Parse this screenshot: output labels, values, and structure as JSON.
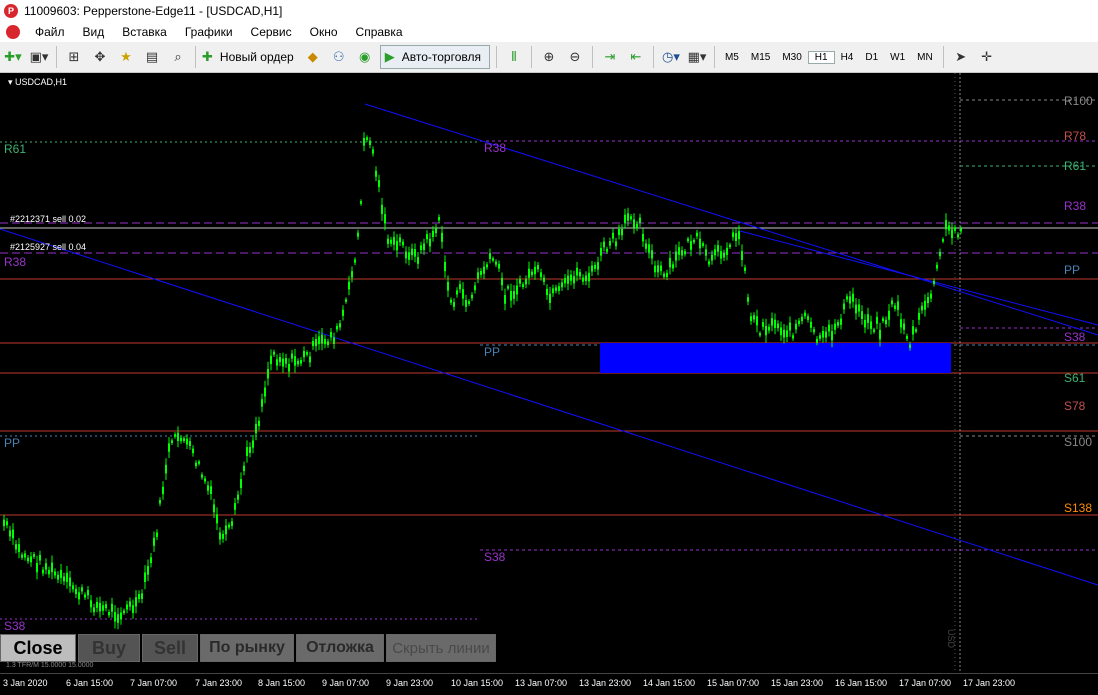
{
  "window": {
    "title": "11009603: Pepperstone-Edge11 - [USDCAD,H1]"
  },
  "menu": [
    "Файл",
    "Вид",
    "Вставка",
    "Графики",
    "Сервис",
    "Окно",
    "Справка"
  ],
  "toolbar": {
    "new_order": "Новый ордер",
    "autotrading": "Авто-торговля",
    "timeframes": [
      "M5",
      "M15",
      "M30",
      "H1",
      "H4",
      "D1",
      "W1",
      "MN"
    ],
    "active_timeframe": "H1"
  },
  "chart": {
    "symbol_label": "USDCAD,H1",
    "orders": [
      "#2212371 sell 0.02",
      "#2125927 sell 0.04"
    ],
    "levels_right": [
      "R100",
      "R78",
      "R61",
      "R38",
      "PP",
      "S38",
      "S61",
      "S78",
      "S100",
      "S138"
    ],
    "levels_left": [
      "R61",
      "R38",
      "PP",
      "S38"
    ],
    "levels_mid": [
      "R38",
      "PP",
      "S38"
    ],
    "level_colors": {
      "R100": "#888888",
      "R78": "#c0504d",
      "R61": "#3cb371",
      "R38": "#9932cc",
      "PP": "#4682b4",
      "S38": "#9932cc",
      "S61": "#3cb371",
      "S78": "#c0504d",
      "S100": "#888888",
      "S138": "#ff8c00"
    },
    "candle_color": "#00ff00",
    "trendline_color": "#0000ff",
    "zone_color": "#0000ff",
    "watermark": "USD"
  },
  "buttons": {
    "close": "Close",
    "buy": "Buy",
    "sell": "Sell",
    "market": "По рынку",
    "pending": "Отложка",
    "hide_lines": "Скрыть линии"
  },
  "bottom_strip": "1.3 TFR/M 15.0000 15.0000",
  "time_axis": [
    "3 Jan 2020",
    "6 Jan 15:00",
    "7 Jan 07:00",
    "7 Jan 23:00",
    "8 Jan 15:00",
    "9 Jan 07:00",
    "9 Jan 23:00",
    "10 Jan 15:00",
    "13 Jan 07:00",
    "13 Jan 23:00",
    "14 Jan 15:00",
    "15 Jan 07:00",
    "15 Jan 23:00",
    "16 Jan 15:00",
    "17 Jan 07:00",
    "17 Jan 23:00"
  ]
}
